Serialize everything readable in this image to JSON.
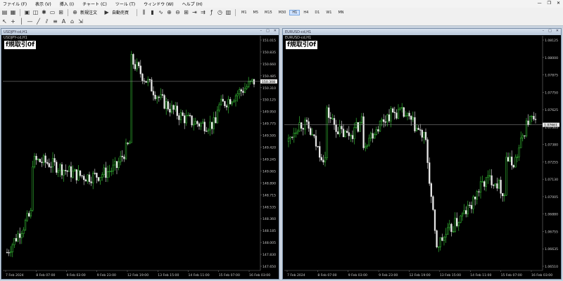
{
  "menu": {
    "items": [
      "ファイル (F)",
      "表示 (V)",
      "挿入 (I)",
      "チャート (C)",
      "ツール (T)",
      "ウィンドウ (W)",
      "ヘルプ (H)"
    ],
    "window_controls": [
      "—",
      "❐",
      "✕"
    ]
  },
  "toolbar": {
    "new_order": "新規注文",
    "auto_trade": "自動売買",
    "timeframes": [
      "M1",
      "M5",
      "M15",
      "M30",
      "H1",
      "H4",
      "D1",
      "W1",
      "MN"
    ],
    "active_timeframe": "H1"
  },
  "charts": [
    {
      "title": "USDJPY-cd,H1",
      "symbol_label": "USDJPY-cd,H1",
      "badge": "f規取引0f",
      "price_labels": [
        "151.015",
        "150.835",
        "150.660",
        "150.485",
        "150.310",
        "150.125",
        "149.950",
        "149.775",
        "149.595",
        "149.420",
        "149.245",
        "149.065",
        "148.890",
        "148.715",
        "148.535",
        "148.360",
        "148.185",
        "148.005",
        "147.830",
        "147.650"
      ],
      "current_price": "150.308",
      "date_labels": [
        "7 Feb 2024",
        "8 Feb 07:00",
        "9 Feb 03:00",
        "9 Feb 23:00",
        "12 Feb 19:00",
        "13 Feb 15:00",
        "14 Feb 11:00",
        "15 Feb 07:00",
        "16 Feb 03:00"
      ],
      "seed": 7
    },
    {
      "title": "EURUSD-cd,H1",
      "symbol_label": "EURUSD-cd,H1",
      "badge": "f規取引0f",
      "price_labels": [
        "1.08125",
        "1.08000",
        "1.07875",
        "1.07750",
        "1.07625",
        "1.07505",
        "1.07380",
        "1.07255",
        "1.07130",
        "1.07005",
        "1.06880",
        "1.06755",
        "1.06635",
        "1.06510"
      ],
      "current_price": "1.07661",
      "date_labels": [
        "7 Feb 2024",
        "8 Feb 07:00",
        "9 Feb 03:00",
        "9 Feb 23:00",
        "12 Feb 19:00",
        "13 Feb 15:00",
        "14 Feb 11:00",
        "15 Feb 07:00",
        "16 Feb 03:00"
      ],
      "seed": 13
    }
  ],
  "colors": {
    "bull": "#3bd23b",
    "bear": "#e8e8e8",
    "grid": "#222",
    "text": "#cfcfcf"
  }
}
